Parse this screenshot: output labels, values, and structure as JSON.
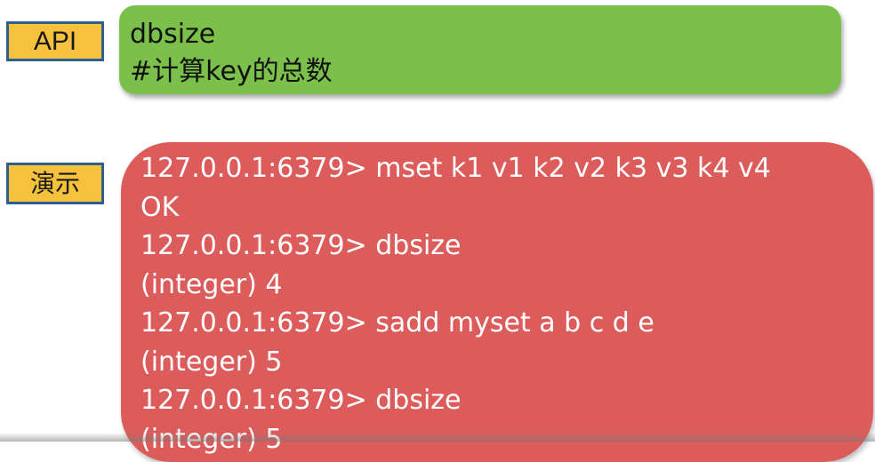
{
  "tags": {
    "api": "API",
    "demo": "演示"
  },
  "api_box": {
    "lines": [
      "dbsize",
      "#计算key的总数"
    ]
  },
  "demo_box": {
    "lines": [
      "127.0.0.1:6379> mset k1 v1 k2 v2 k3 v3 k4 v4",
      "OK",
      "127.0.0.1:6379> dbsize",
      "(integer) 4",
      "127.0.0.1:6379> sadd myset a b c d e",
      "(integer) 5",
      "127.0.0.1:6379> dbsize",
      "(integer) 5"
    ]
  },
  "colors": {
    "tag_fill": "#f7c23b",
    "tag_border": "#2f5f92",
    "api_box": "#7bc04a",
    "demo_box": "#dc5c5c"
  }
}
